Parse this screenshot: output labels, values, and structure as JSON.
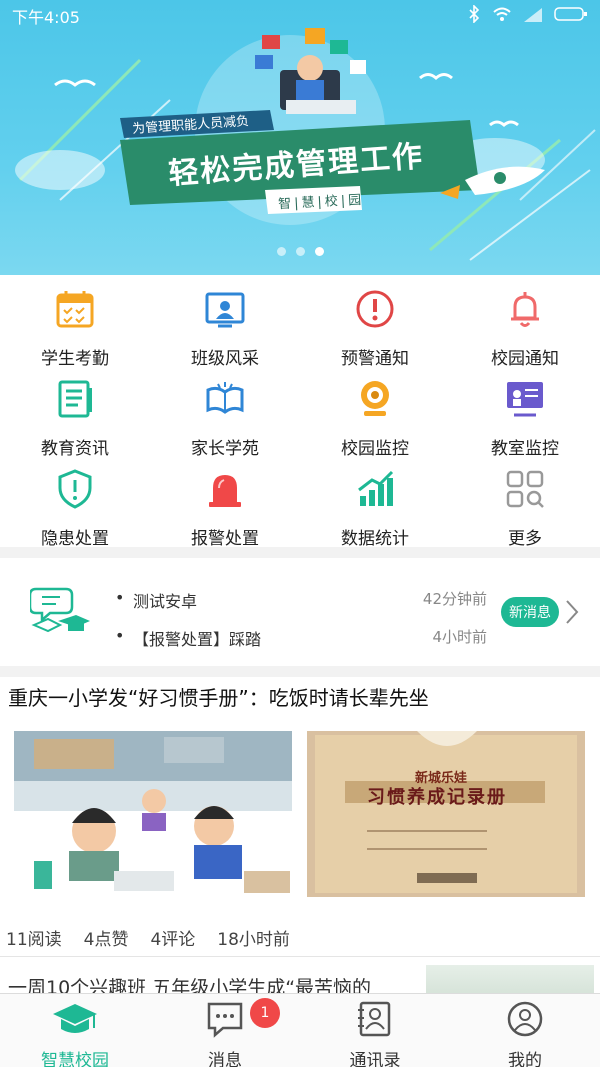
{
  "status_bar": {
    "time": "下午4:05"
  },
  "banner": {
    "subtitle": "为管理职能人员减负",
    "title": "轻松完成管理工作",
    "tagline": "智|慧|校|园",
    "slide_count": 3,
    "active_slide": 3
  },
  "grid": [
    {
      "label": "学生考勤",
      "icon": "attendance-calendar-icon",
      "color": "#f5a623"
    },
    {
      "label": "班级风采",
      "icon": "class-showcase-icon",
      "color": "#2f86d6"
    },
    {
      "label": "预警通知",
      "icon": "warning-alert-icon",
      "color": "#e04646"
    },
    {
      "label": "校园通知",
      "icon": "bell-icon",
      "color": "#f06a6a"
    },
    {
      "label": "教育资讯",
      "icon": "news-document-icon",
      "color": "#1eb894"
    },
    {
      "label": "家长学苑",
      "icon": "open-book-icon",
      "color": "#2f86d6"
    },
    {
      "label": "校园监控",
      "icon": "webcam-icon",
      "color": "#f5a623"
    },
    {
      "label": "教室监控",
      "icon": "classroom-monitor-icon",
      "color": "#6a5acd"
    },
    {
      "label": "隐患处置",
      "icon": "shield-icon",
      "color": "#1eb894"
    },
    {
      "label": "报警处置",
      "icon": "alarm-siren-icon",
      "color": "#f04848"
    },
    {
      "label": "数据统计",
      "icon": "bar-chart-icon",
      "color": "#1eb894"
    },
    {
      "label": "更多",
      "icon": "more-grid-icon",
      "color": "#999999"
    }
  ],
  "ticker": {
    "items": [
      {
        "title": "测试安卓",
        "time": "42分钟前"
      },
      {
        "title": "【报警处置】踩踏",
        "time": "4小时前"
      }
    ],
    "new_label": "新消息"
  },
  "article": {
    "title": "重庆一小学发“好习惯手册”：吃饭时请长辈先坐",
    "reads": "11阅读",
    "likes": "4点赞",
    "comments": "4评论",
    "time": "18小时前",
    "booklet_brand": "新城乐娃",
    "booklet_title": "习惯养成记录册",
    "next_title": "一周10个兴趣班 五年级小学生成“最苦恼的"
  },
  "tabs": [
    {
      "label": "智慧校园",
      "icon": "graduation-cap-icon",
      "active": true
    },
    {
      "label": "消息",
      "icon": "message-bubble-icon",
      "badge": "1"
    },
    {
      "label": "通讯录",
      "icon": "contacts-icon"
    },
    {
      "label": "我的",
      "icon": "profile-icon"
    }
  ],
  "colors": {
    "accent": "#1eb894",
    "banner_sky": "#4cc6e8",
    "badge_red": "#f04848"
  }
}
